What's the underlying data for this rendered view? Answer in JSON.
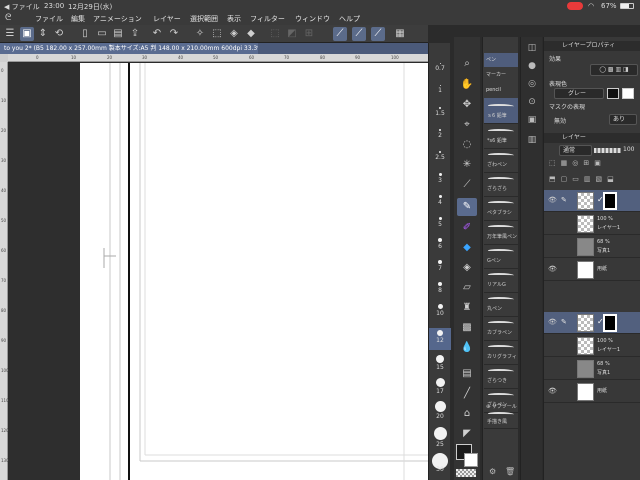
{
  "status": {
    "back_app": "◀ ファイル",
    "time": "23:00",
    "date": "12月29日(水)",
    "battery": "67%"
  },
  "menu": {
    "items": [
      "ファイル",
      "編集",
      "アニメーション",
      "レイヤー",
      "選択範囲",
      "表示",
      "フィルター",
      "ウィンドウ",
      "ヘルプ"
    ]
  },
  "document": {
    "tab_title": "to you 2* (B5 182.00 x 257.00mm 製本サイズ:A5 判 148.00 x 210.00mm 600dpi 33.3%)"
  },
  "rulers": {
    "top": [
      "0",
      "10",
      "20",
      "30",
      "40",
      "50",
      "60",
      "70",
      "80",
      "90",
      "100"
    ],
    "left": [
      "0",
      "10",
      "20",
      "30",
      "40",
      "50",
      "60",
      "70",
      "80",
      "90",
      "100",
      "110",
      "120",
      "130"
    ]
  },
  "brush_sizes": [
    "0.7",
    "1",
    "1.5",
    "2",
    "2.5",
    "3",
    "4",
    "5",
    "6",
    "7",
    "8",
    "10",
    "12",
    "15",
    "17",
    "20",
    "25",
    "30"
  ],
  "brush_selected": "12",
  "subtool": {
    "groups": [
      "ペン",
      "マーカー",
      "pencil"
    ],
    "brushes": [
      "ｓ6 鉛筆",
      "*s6 鉛筆",
      "ざわペン",
      "ざらざら",
      "ペタブラシ",
      "万年筆風ペン",
      "Gペン",
      "リアルG",
      "丸ペン",
      "カブラペン",
      "カリグラフィ",
      "ざらつき",
      "ざらペン",
      "手描き風"
    ],
    "add_label": "⊕ サブツール"
  },
  "layer_property": {
    "header": "レイヤープロパティ",
    "effect_label": "効果",
    "expression_label": "表現色",
    "expression_value": "グレー",
    "mask_label": "マスクの表現",
    "mask_value1": "無効",
    "mask_value2": "あり"
  },
  "layer_panel": {
    "header": "レイヤー",
    "blend": "通常",
    "opacity": "100",
    "layers": [
      {
        "name": "",
        "pct": "",
        "type": "mask",
        "selected": true
      },
      {
        "name": "レイヤー1",
        "pct": "100 %",
        "type": "checker",
        "selected": false
      },
      {
        "name": "写真1",
        "pct": "68 %",
        "type": "photo",
        "selected": false
      },
      {
        "name": "用紙",
        "pct": "",
        "type": "white",
        "selected": false
      },
      {
        "name": "",
        "pct": "",
        "type": "mask",
        "selected": true
      },
      {
        "name": "レイヤー1",
        "pct": "100 %",
        "type": "checker",
        "selected": false
      },
      {
        "name": "写真1",
        "pct": "68 %",
        "type": "photo",
        "selected": false
      },
      {
        "name": "用紙",
        "pct": "",
        "type": "white",
        "selected": false
      }
    ]
  }
}
